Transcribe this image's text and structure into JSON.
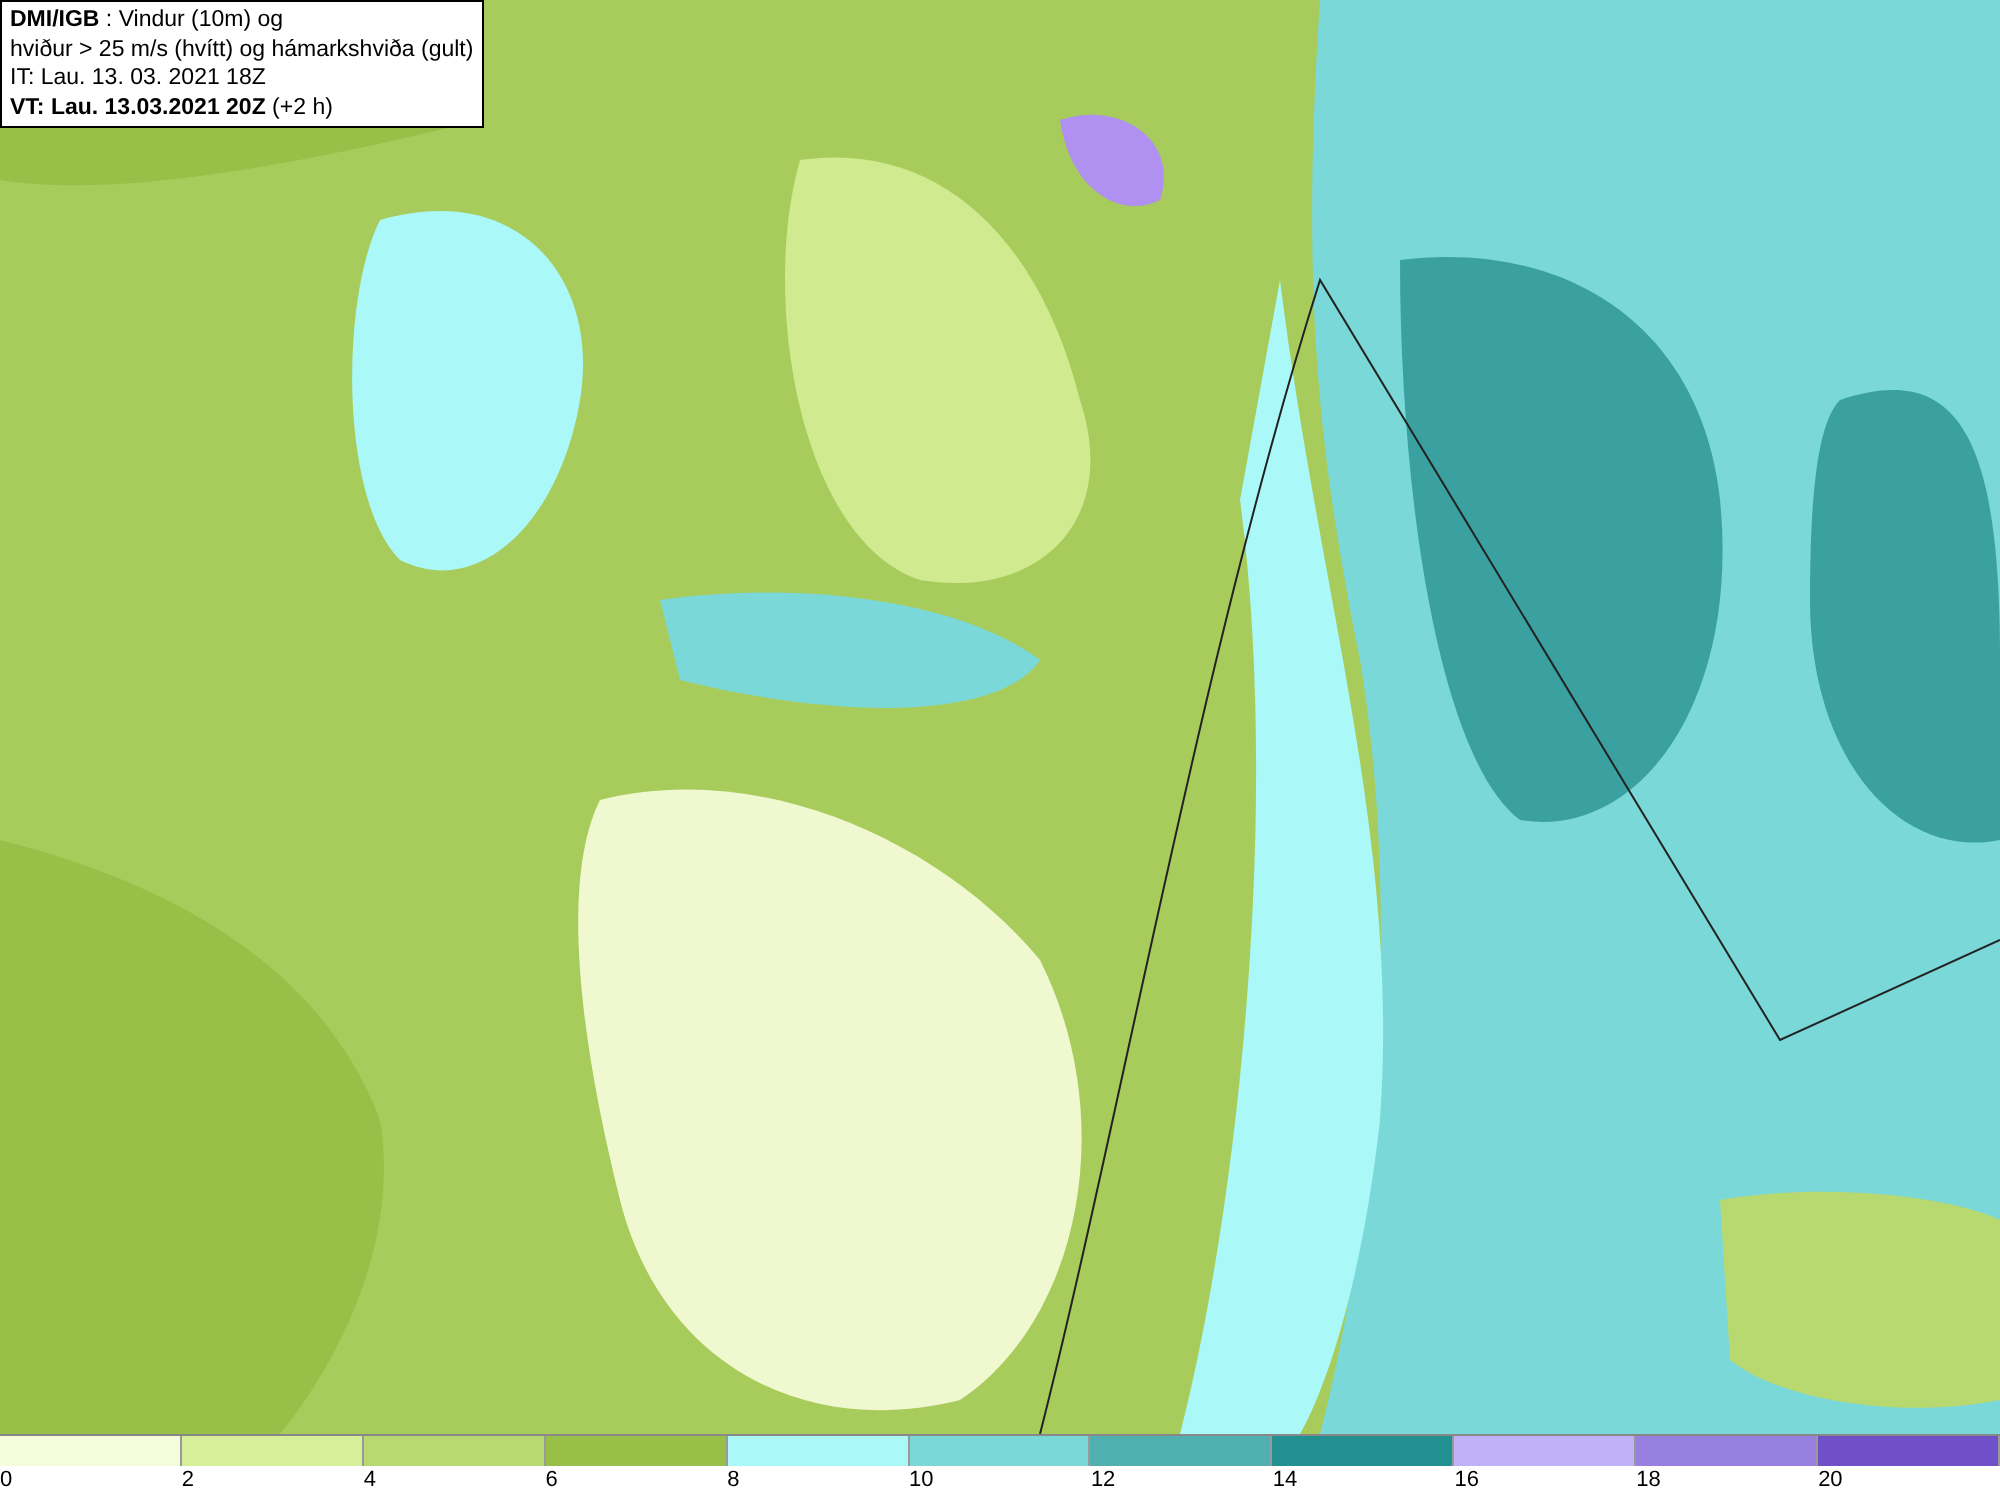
{
  "header": {
    "lines": [
      "**DMI/IGB** : Vindur (10m) og",
      "hviður > 25 m/s (hvítt) og hámarkshviða (gult)",
      "IT: Lau. 13. 03. 2021 18Z",
      "**VT: Lau. 13.03.2021 20Z** (+2 h)"
    ]
  },
  "legend": {
    "swatches": [
      {
        "color": "#f5fcdc"
      },
      {
        "color": "#d8ef9a"
      },
      {
        "color": "#b8d870"
      },
      {
        "color": "#98c048"
      },
      {
        "color": "#aaf8f8"
      },
      {
        "color": "#7ad8d8"
      },
      {
        "color": "#50b0b0"
      },
      {
        "color": "#209090"
      },
      {
        "color": "#c0b0f8"
      },
      {
        "color": "#9880e0"
      },
      {
        "color": "#7050c8"
      }
    ],
    "ticks": [
      "0",
      "2",
      "4",
      "6",
      "8",
      "10",
      "12",
      "14",
      "16",
      "18",
      "20"
    ]
  }
}
